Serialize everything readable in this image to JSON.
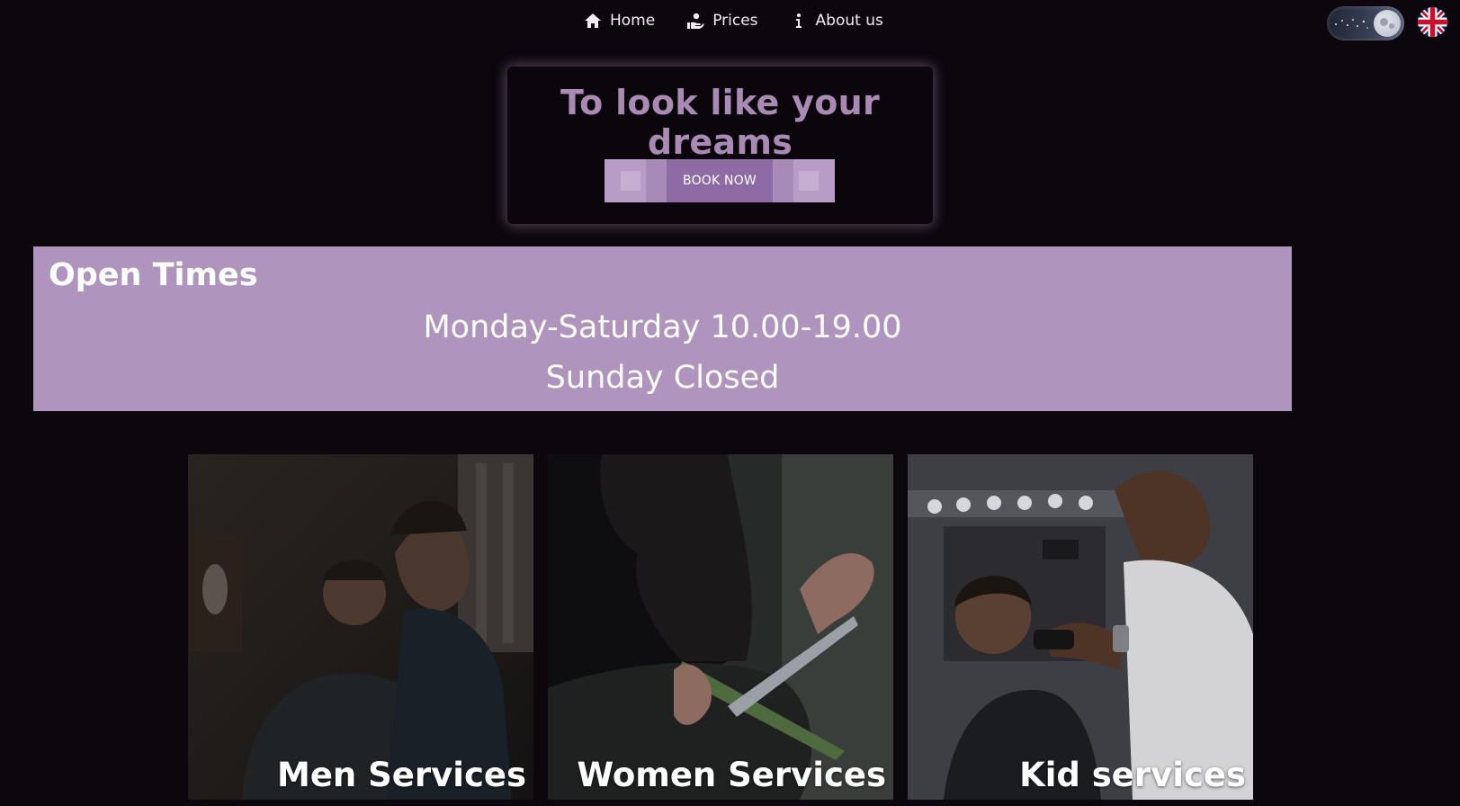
{
  "nav": {
    "items": [
      {
        "label": "Home",
        "icon": "home-icon"
      },
      {
        "label": "Prices",
        "icon": "hand-coin-icon"
      },
      {
        "label": "About us",
        "icon": "info-icon"
      }
    ],
    "theme_toggle": {
      "state": "dark"
    },
    "language_flag": {
      "icon": "uk-flag-icon"
    }
  },
  "hero": {
    "title": "To look like your dreams",
    "button_label": "BOOK NOW"
  },
  "open_times": {
    "title": "Open Times",
    "lines": [
      "Monday-Saturday 10.00-19.00",
      "Sunday Closed"
    ]
  },
  "services": [
    {
      "label": "Men Services"
    },
    {
      "label": "Women Services"
    },
    {
      "label": "Kid services"
    }
  ],
  "colors": {
    "background": "#0b070d",
    "accent": "#af94bd",
    "hero_title": "#a98ab4"
  }
}
